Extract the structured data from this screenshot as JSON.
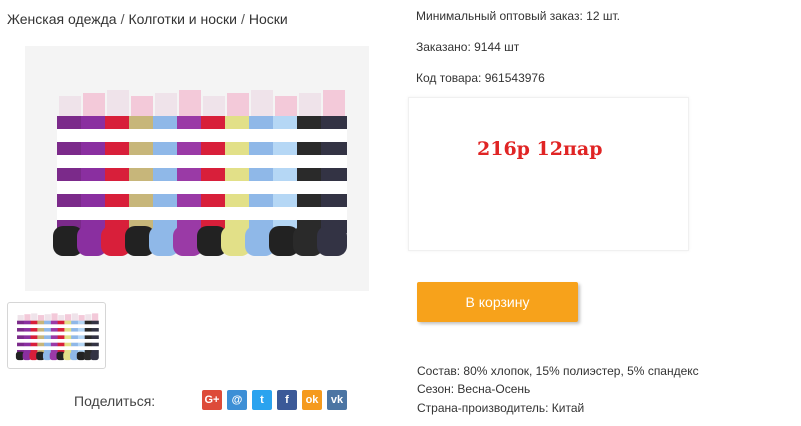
{
  "breadcrumb": {
    "items": [
      "Женская одежда",
      "Колготки и носки",
      "Носки"
    ],
    "separator": "/"
  },
  "product": {
    "min_order": "Минимальный оптовый заказ: 12 шт.",
    "ordered": "Заказано: 9144 шт",
    "code": "Код товара: 961543976",
    "price_text": "216р 12пар",
    "cart_button": "В корзину",
    "composition": "Состав: 80% хлопок, 15% полиэстер, 5% спандекс",
    "season": "Сезон: Весна-Осень",
    "country": "Страна-производитель: Китай"
  },
  "share": {
    "label": "Поделиться:",
    "icons": [
      {
        "name": "google-plus-icon",
        "glyph": "G+",
        "color": "#dd4b39"
      },
      {
        "name": "email-icon",
        "glyph": "@",
        "color": "#3d8fd6"
      },
      {
        "name": "twitter-icon",
        "glyph": "t",
        "color": "#2aa3ef"
      },
      {
        "name": "facebook-icon",
        "glyph": "f",
        "color": "#3b5998"
      },
      {
        "name": "odnoklassniki-icon",
        "glyph": "ok",
        "color": "#f59a1d"
      },
      {
        "name": "vk-icon",
        "glyph": "vk",
        "color": "#4c75a3"
      }
    ]
  },
  "colors": {
    "accent_button": "#f7a21b",
    "price": "#e02424"
  },
  "sock_colors": [
    "#7b2a8a",
    "#8a2fa0",
    "#d81f3a",
    "#c7b67a",
    "#8fb8e8",
    "#9a3aa6",
    "#d81f3a",
    "#e2e088",
    "#8fb8e8",
    "#b5d7f5",
    "#2a2a2a",
    "#333344"
  ]
}
